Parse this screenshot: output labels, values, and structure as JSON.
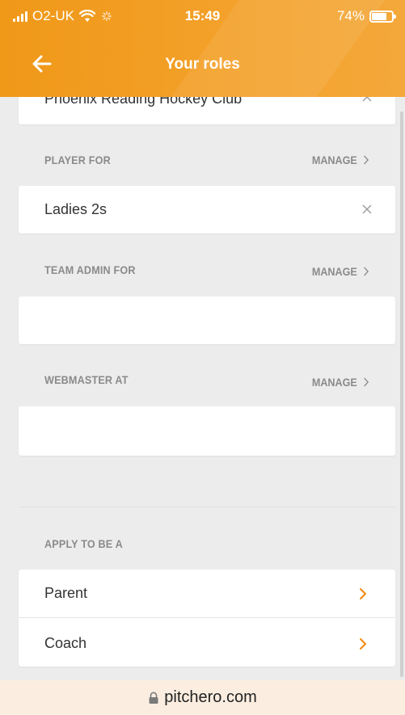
{
  "status_bar": {
    "carrier": "O2-UK",
    "time": "15:49",
    "battery": "74%",
    "battery_level": 0.74
  },
  "header": {
    "title": "Your roles"
  },
  "club_card": {
    "label": "Phoenix Reading Hockey Club"
  },
  "sections": {
    "player": {
      "label": "PLAYER FOR",
      "manage": "MANAGE",
      "item": "Ladies 2s"
    },
    "team_admin": {
      "label": "TEAM ADMIN FOR",
      "manage": "MANAGE"
    },
    "webmaster": {
      "label": "WEBMASTER AT",
      "manage": "MANAGE"
    },
    "apply": {
      "label": "APPLY TO BE A",
      "items": [
        "Parent",
        "Coach"
      ]
    }
  },
  "url_bar": {
    "domain": "pitchero.com"
  },
  "colors": {
    "accent": "#f39c1f",
    "chevron": "#f08a0c"
  }
}
